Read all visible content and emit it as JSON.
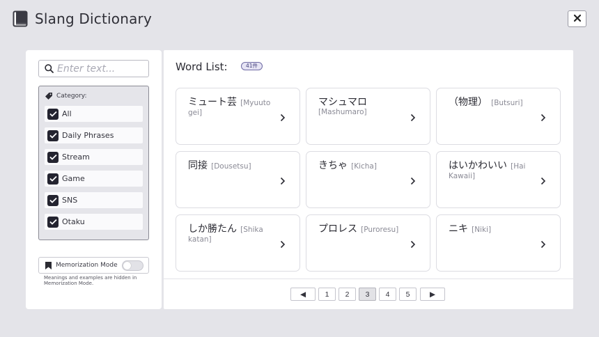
{
  "app": {
    "title": "Slang Dictionary",
    "close_label": "✕"
  },
  "search": {
    "placeholder": "Enter text...",
    "value": ""
  },
  "category": {
    "label": "Category:",
    "items": [
      {
        "label": "All",
        "checked": true
      },
      {
        "label": "Daily Phrases",
        "checked": true
      },
      {
        "label": "Stream",
        "checked": true
      },
      {
        "label": "Game",
        "checked": true
      },
      {
        "label": "SNS",
        "checked": true
      },
      {
        "label": "Otaku",
        "checked": true
      }
    ]
  },
  "memorization": {
    "label": "Memorization Mode",
    "enabled": false,
    "note": "Meanings and examples are hidden in Memorization Mode."
  },
  "word_list": {
    "heading": "Word List:",
    "count_badge": "41件",
    "cards": [
      {
        "word": "ミュート芸",
        "reading": "[Myuuto gei]"
      },
      {
        "word": "マシュマロ",
        "reading": "[Mashumaro]"
      },
      {
        "word": "（物理）",
        "reading": "[Butsuri]"
      },
      {
        "word": "同接",
        "reading": "[Dousetsu]"
      },
      {
        "word": "きちゃ",
        "reading": "[Kicha]"
      },
      {
        "word": "はいかわいい",
        "reading": "[Hai Kawaii]"
      },
      {
        "word": "しか勝たん",
        "reading": "[Shika katan]"
      },
      {
        "word": "プロレス",
        "reading": "[Puroresu]"
      },
      {
        "word": "ニキ",
        "reading": "[Niki]"
      }
    ]
  },
  "pagination": {
    "prev_label": "◀",
    "next_label": "▶",
    "pages": [
      "1",
      "2",
      "3",
      "4",
      "5"
    ],
    "current_page": "3"
  },
  "colors": {
    "background": "#e4e4e9",
    "panel": "#ffffff",
    "checkbox": "#242430",
    "badge_border": "#6e6aa3"
  },
  "icons": {
    "app": "book-icon",
    "close": "close-icon",
    "search": "search-icon",
    "category": "tag-icon",
    "memorization": "bookmark-icon",
    "card": "chevron-right-icon"
  }
}
